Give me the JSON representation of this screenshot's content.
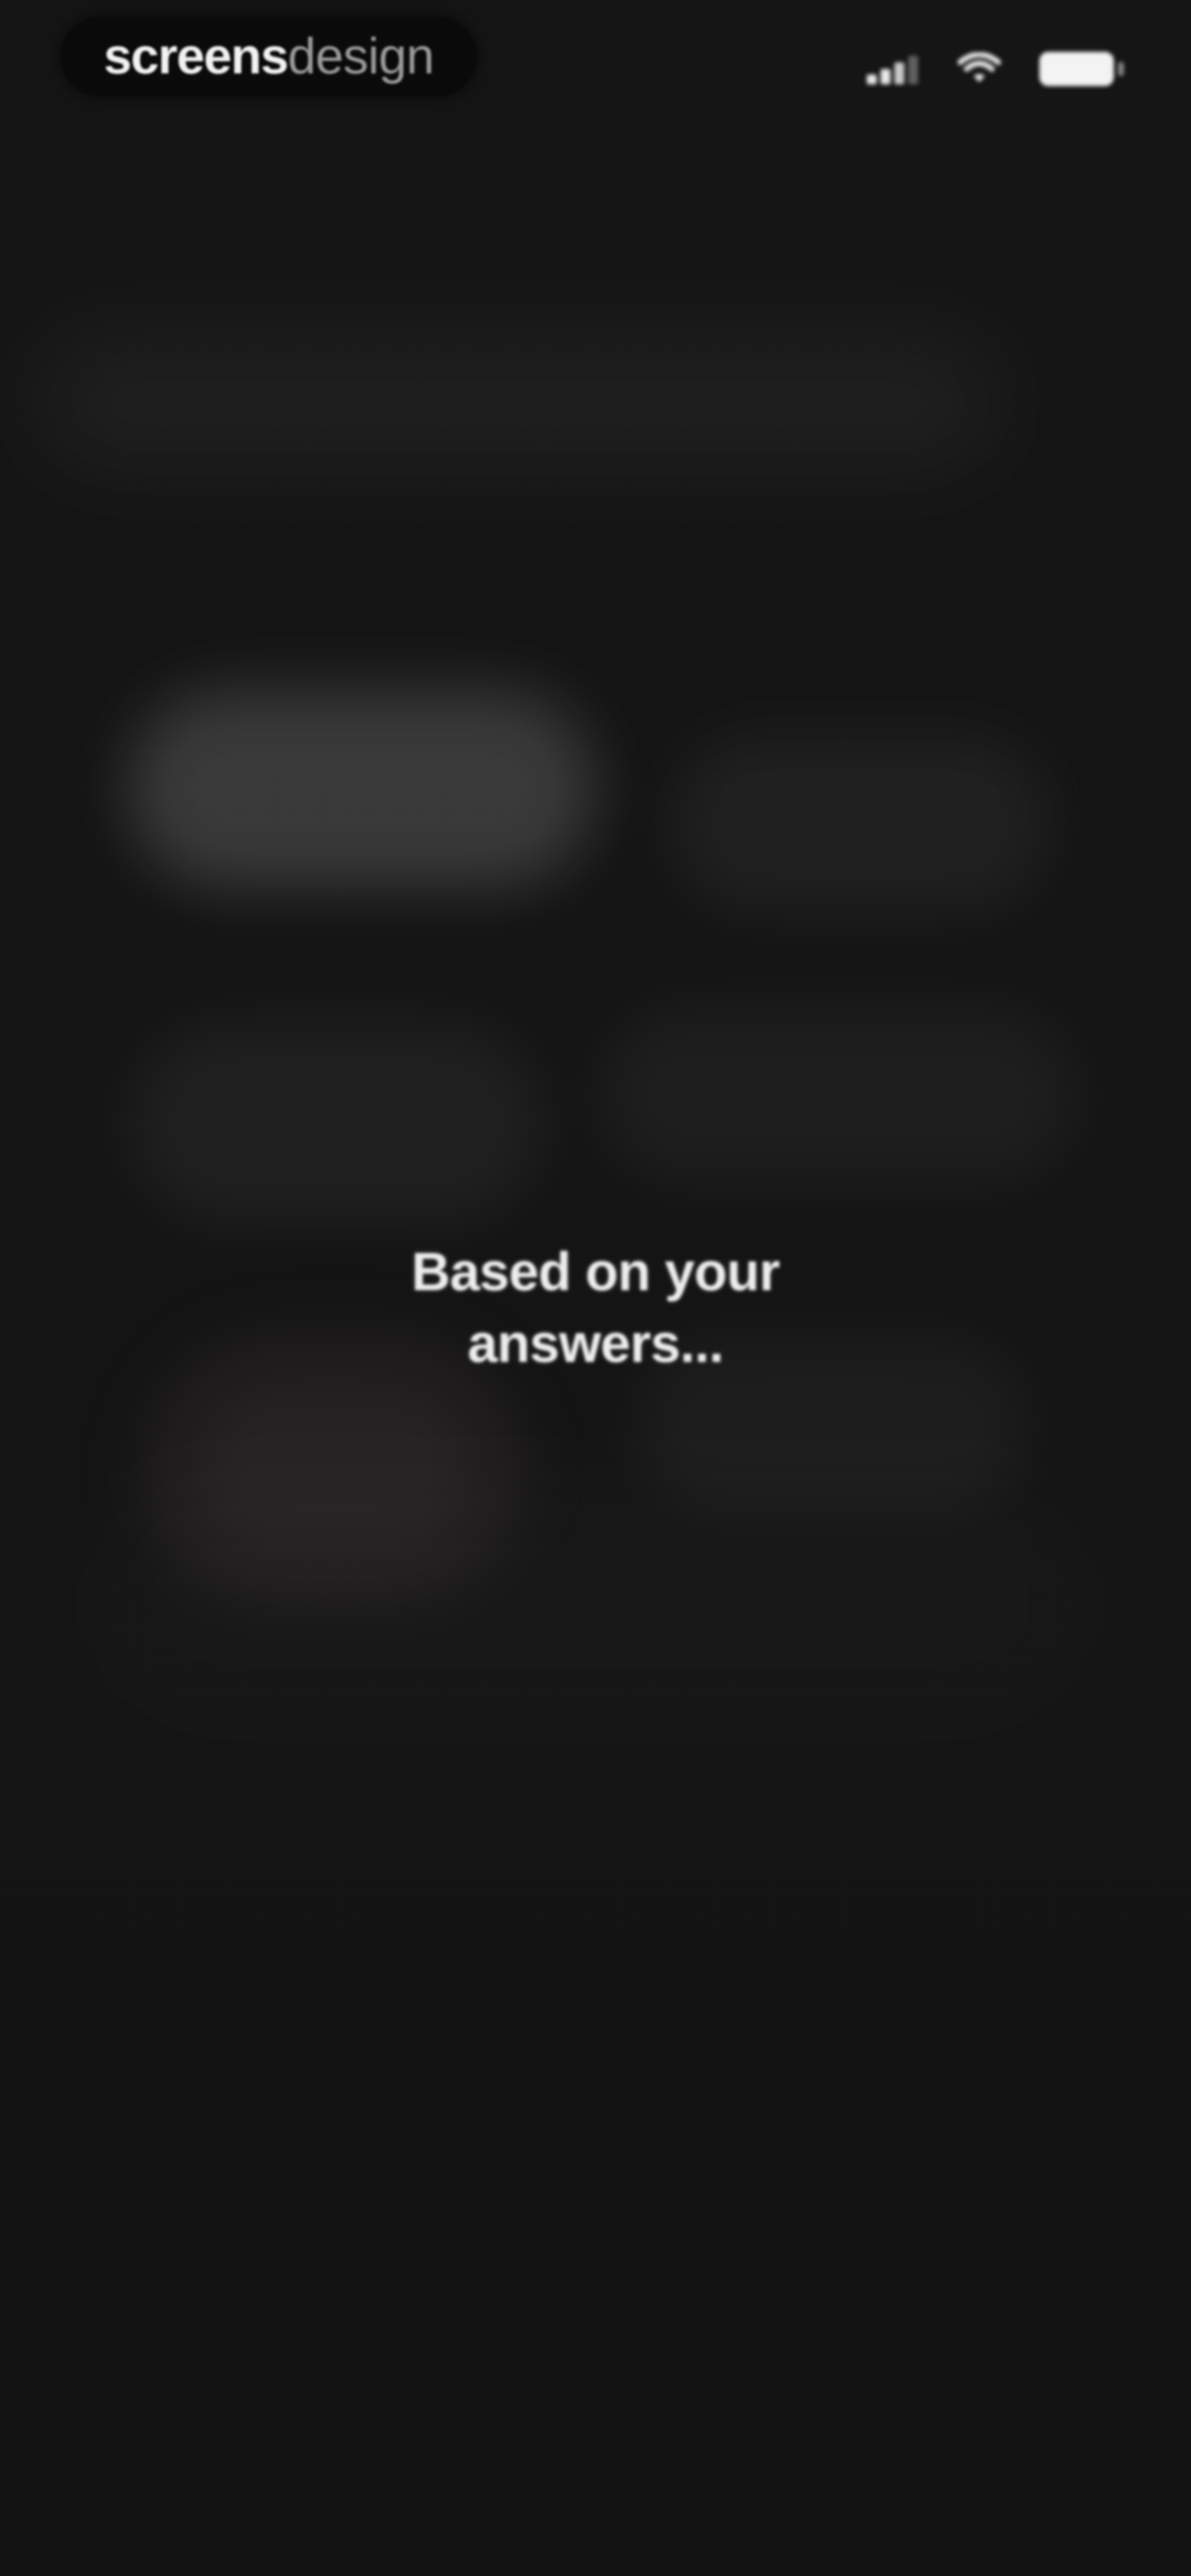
{
  "brand": {
    "part1": "screens",
    "part2": "design"
  },
  "status_bar": {
    "icons": [
      "signal-icon",
      "wifi-icon",
      "battery-icon"
    ]
  },
  "main": {
    "message_line1": "Based on your",
    "message_line2": "answers..."
  },
  "colors": {
    "background": "#141414",
    "text": "#EDEDED",
    "muted_text": "#9A9A9A",
    "accent_glow": "#FFBEDC"
  }
}
